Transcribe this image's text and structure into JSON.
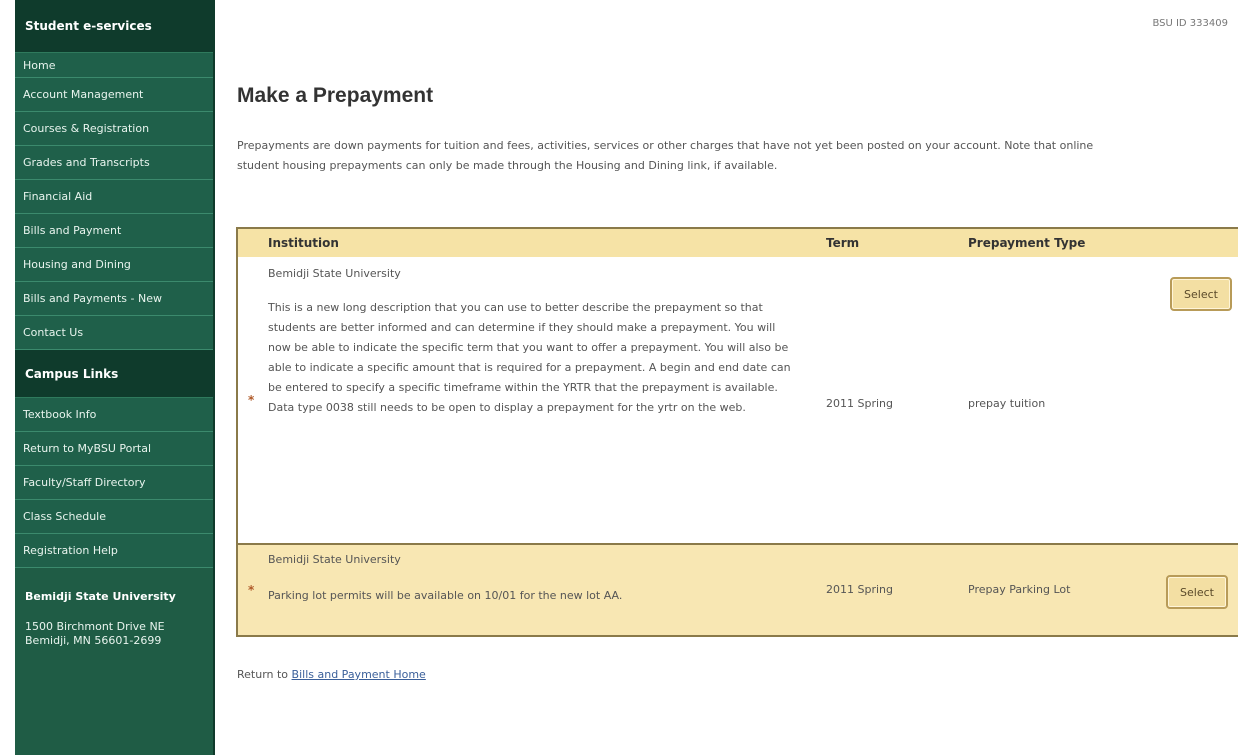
{
  "sidebar": {
    "header": "Student e-services",
    "items": [
      "Home",
      "Account Management",
      "Courses & Registration",
      "Grades and Transcripts",
      "Financial Aid",
      "Bills and Payment",
      "Housing and Dining",
      "Bills and Payments - New",
      "Contact Us"
    ],
    "campus_header": "Campus Links",
    "campus_items": [
      "Textbook Info",
      "Return to MyBSU Portal",
      "Faculty/Staff Directory",
      "Class Schedule",
      "Registration Help"
    ],
    "institution": "Bemidji State University",
    "address_line1": "1500 Birchmont Drive NE",
    "address_line2": "Bemidji, MN 56601-2699"
  },
  "header": {
    "id_text": "BSU ID 333409"
  },
  "page": {
    "title": "Make a Prepayment",
    "intro": "Prepayments are down payments for tuition and fees, activities, services or other charges that have not yet been posted on your account.   Note that online student housing prepayments can only be made through the Housing and Dining link, if available."
  },
  "table": {
    "headers": {
      "institution": "Institution",
      "term": "Term",
      "type": "Prepayment Type"
    },
    "rows": [
      {
        "marker": "*",
        "institution": "Bemidji State University",
        "description": "This is a new long description that you can use to better describe the prepayment so that students are better informed and can determine if they should make a prepayment. You will now be able to indicate the specific term that you want to offer a prepayment. You will also be able to indicate a specific amount that is required for a prepayment. A begin and end date can be entered to specify a specific timeframe within the YRTR that the prepayment is available. Data type 0038 still needs to be open to display a prepayment for the yrtr on the web.",
        "term": "2011 Spring",
        "type": "prepay tuition",
        "button": "Select"
      },
      {
        "marker": "*",
        "institution": "Bemidji State University",
        "description": "Parking lot permits will be available on 10/01 for the new lot AA.",
        "term": "2011 Spring",
        "type": "Prepay Parking Lot",
        "button": "Select"
      }
    ]
  },
  "footer": {
    "prefix": "Return to",
    "link": "Bills and Payment Home"
  },
  "colors": {
    "sidebar_bg": "#1f604a",
    "sidebar_header_bg": "#0f3b2c",
    "table_header_bg": "#f6e3a6",
    "row_highlight_bg": "#f8e7b3",
    "border": "#8a7a4a"
  }
}
